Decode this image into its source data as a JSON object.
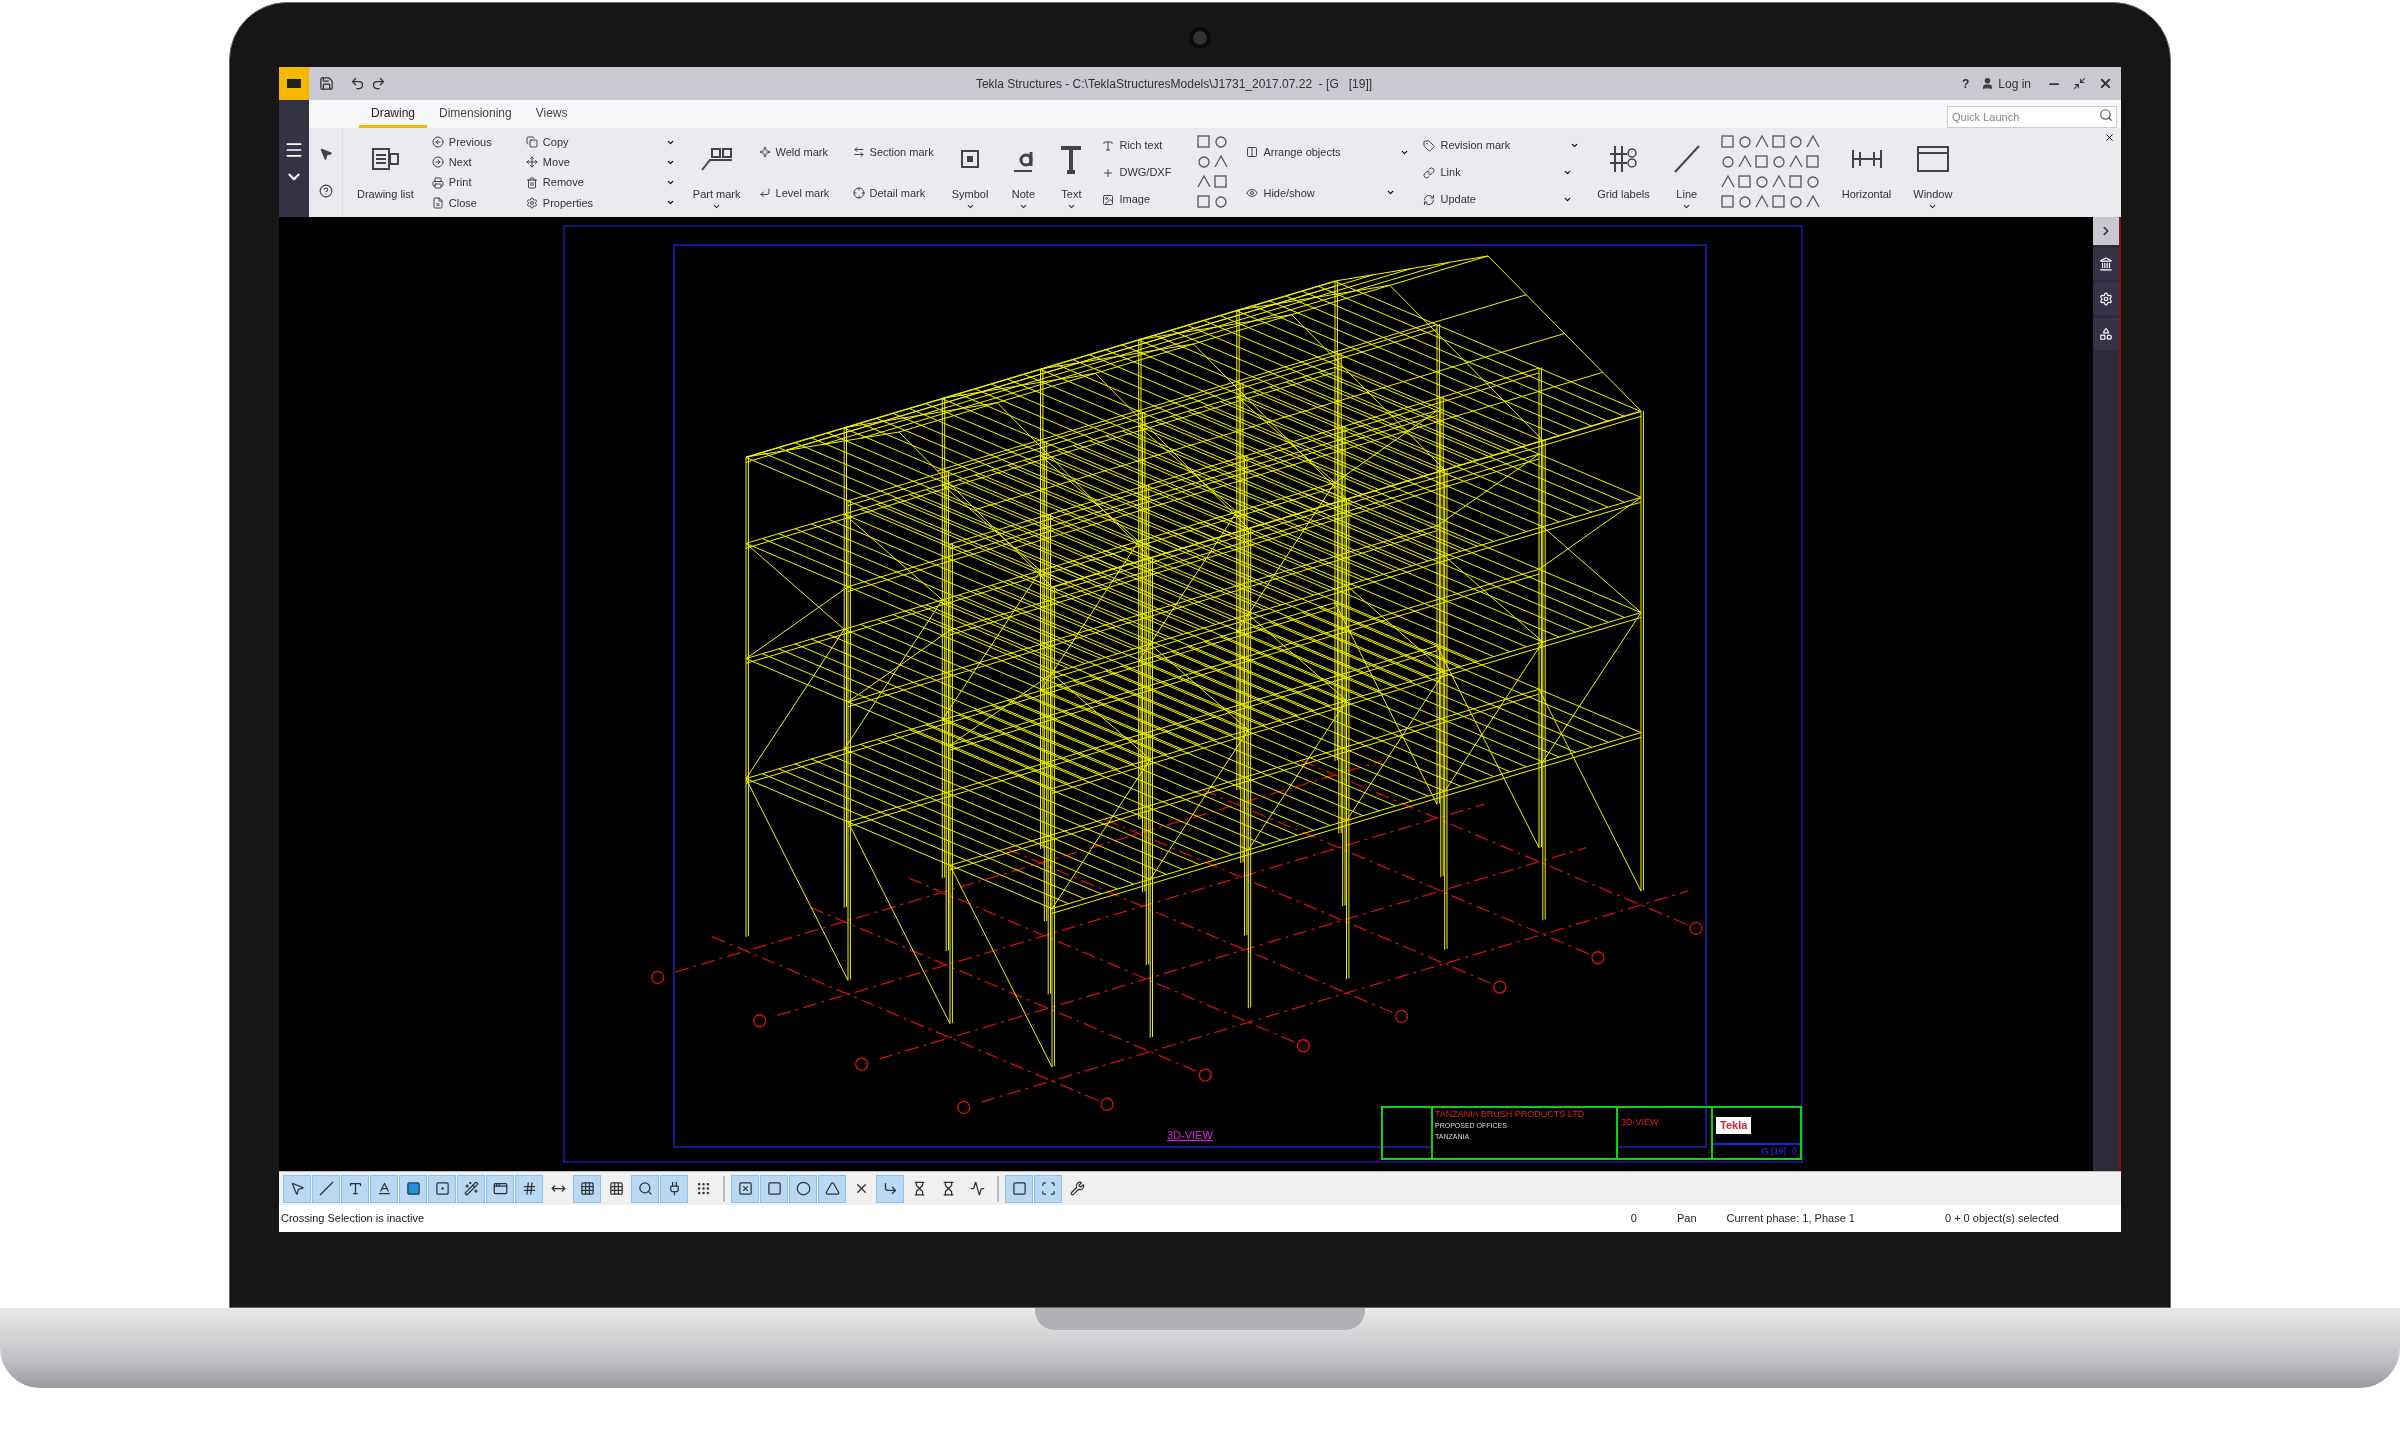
{
  "window": {
    "title": "Tekla Structures - C:\\TeklaStructuresModels\\J1731_2017.07.22  - [G   [19]]",
    "help": "?",
    "login": "Log in"
  },
  "quick_launch": {
    "placeholder": "Quick Launch"
  },
  "tabs": [
    {
      "label": "Drawing",
      "selected": true
    },
    {
      "label": "Dimensioning",
      "selected": false
    },
    {
      "label": "Views",
      "selected": false
    }
  ],
  "ribbon": [
    {
      "kind": "large",
      "label": "Drawing list",
      "has_menu": false
    },
    {
      "kind": "stack",
      "items": [
        {
          "label": "Previous",
          "has_menu": false
        },
        {
          "label": "Next",
          "has_menu": false
        },
        {
          "label": "Print",
          "has_menu": false
        },
        {
          "label": "Close",
          "has_menu": false
        }
      ]
    },
    {
      "kind": "stack",
      "items": [
        {
          "label": "Copy",
          "has_menu": true
        },
        {
          "label": "Move",
          "has_menu": true
        },
        {
          "label": "Remove",
          "has_menu": true
        },
        {
          "label": "Properties",
          "has_menu": true
        }
      ]
    },
    {
      "kind": "large",
      "label": "Part mark",
      "has_menu": true
    },
    {
      "kind": "stack",
      "items": [
        {
          "label": "Weld mark",
          "has_menu": false
        },
        {
          "label": "Level mark",
          "has_menu": false
        }
      ]
    },
    {
      "kind": "stack",
      "items": [
        {
          "label": "Section mark",
          "has_menu": false
        },
        {
          "label": "Detail mark",
          "has_menu": false
        }
      ]
    },
    {
      "kind": "large",
      "label": "Symbol",
      "has_menu": true
    },
    {
      "kind": "large",
      "label": "Note",
      "has_menu": true
    },
    {
      "kind": "large",
      "label": "Text",
      "has_menu": true
    },
    {
      "kind": "stack",
      "items": [
        {
          "label": "Rich text",
          "has_menu": false
        },
        {
          "label": "DWG/DXF",
          "has_menu": false
        },
        {
          "label": "Image",
          "has_menu": false
        }
      ]
    },
    {
      "kind": "alignment"
    },
    {
      "kind": "stack",
      "items": [
        {
          "label": "Arrange objects",
          "has_menu": true
        },
        {
          "label": "Hide/show",
          "has_menu": true
        }
      ]
    },
    {
      "kind": "stack",
      "items": [
        {
          "label": "Revision mark",
          "has_menu": true
        },
        {
          "label": "Link",
          "has_menu": true
        },
        {
          "label": "Update",
          "has_menu": true
        }
      ]
    },
    {
      "kind": "large",
      "label": "Grid labels",
      "has_menu": false
    },
    {
      "kind": "large",
      "label": "Line",
      "has_menu": true
    },
    {
      "kind": "shapes"
    },
    {
      "kind": "large",
      "label": "Horizontal",
      "has_menu": false
    },
    {
      "kind": "large",
      "label": "Window",
      "has_menu": true
    }
  ],
  "drawing": {
    "view_label": "3D-VIEW",
    "title_block": {
      "company": "TANZANIA BRUSH PRODUCTS LTD",
      "project": "PROPOSED OFFICES",
      "location": "TANZANIA",
      "view": "3D-VIEW",
      "logo": "Tekla",
      "sheet": "G [19]",
      "revision": "0"
    }
  },
  "bottom_toolbar": [
    {
      "selected": true
    },
    {
      "selected": true
    },
    {
      "selected": true
    },
    {
      "selected": true
    },
    {
      "selected": true
    },
    {
      "selected": true
    },
    {
      "selected": true
    },
    {
      "selected": true
    },
    {
      "selected": true
    },
    {
      "selected": false
    },
    {
      "selected": true
    },
    {
      "selected": false
    },
    {
      "selected": true
    },
    {
      "selected": true
    },
    {
      "selected": false
    },
    {
      "selected": true
    },
    {
      "selected": true
    },
    {
      "selected": true
    },
    {
      "selected": true
    },
    {
      "selected": false
    },
    {
      "selected": true
    },
    {
      "selected": false
    },
    {
      "selected": false
    },
    {
      "selected": false
    },
    {
      "selected": true
    },
    {
      "selected": true
    },
    {
      "selected": false
    }
  ],
  "status_bar": {
    "message": "Crossing Selection is inactive",
    "count": "0",
    "mode": "Pan",
    "phase": "Current phase: 1, Phase 1",
    "selection": "0 + 0 object(s) selected"
  }
}
